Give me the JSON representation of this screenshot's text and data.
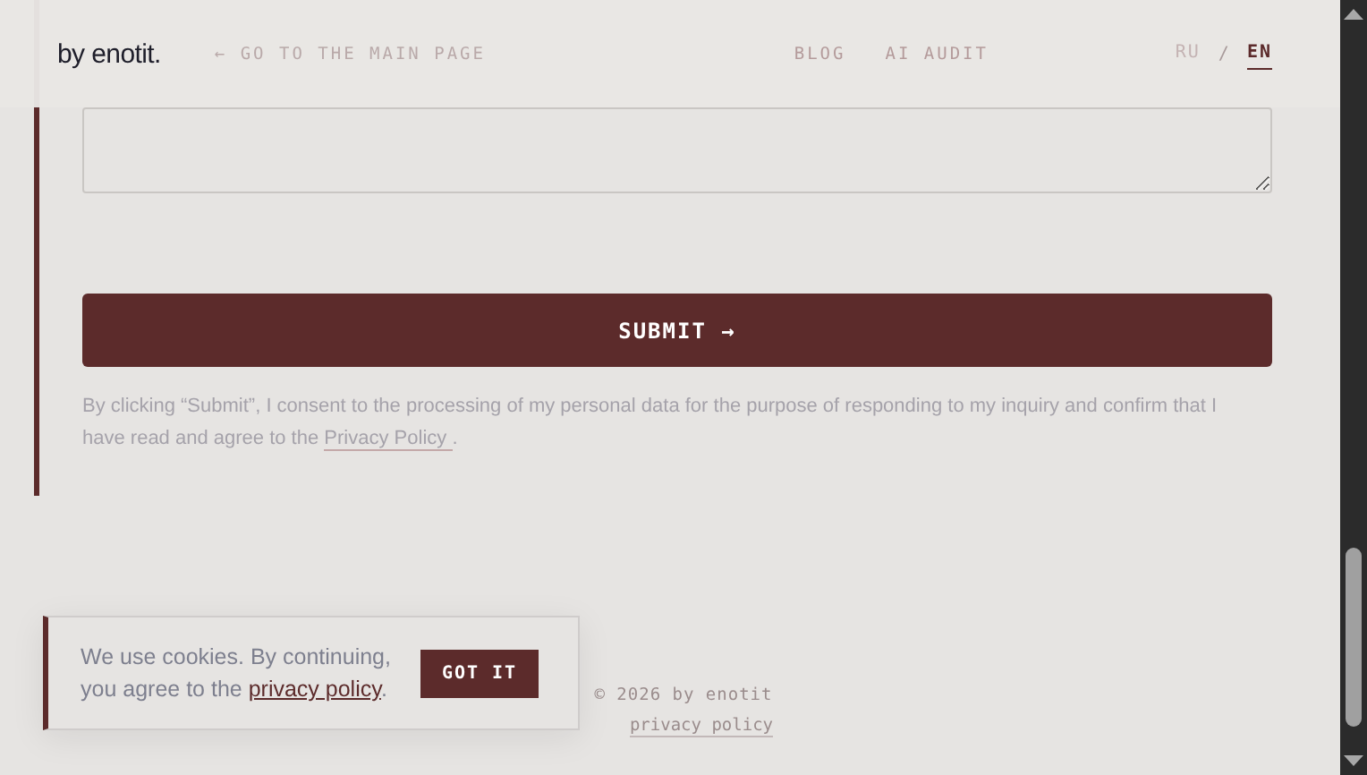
{
  "header": {
    "logo": "by enotit.",
    "back_link": "← GO TO THE MAIN PAGE",
    "nav": [
      {
        "label": "BLOG"
      },
      {
        "label": "AI AUDIT"
      }
    ],
    "languages": [
      {
        "label": "RU",
        "selected": false
      },
      {
        "label": "EN",
        "selected": true
      }
    ],
    "language_separator": "/"
  },
  "form": {
    "submit_button": "SUBMIT →",
    "consent_text": "By clicking “Submit”, I consent to the processing of my personal data for the purpose of responding to my inquiry and confirm that I have read and agree to the ",
    "consent_link": "Privacy Policy ",
    "consent_end": "."
  },
  "footer": {
    "copyright": "© 2026 by enotit",
    "privacy_link": "privacy policy"
  },
  "cookie_banner": {
    "text": "We use cookies. By continuing, you agree to the ",
    "link": "privacy policy",
    "text_end": ".",
    "button": "GOT IT"
  }
}
